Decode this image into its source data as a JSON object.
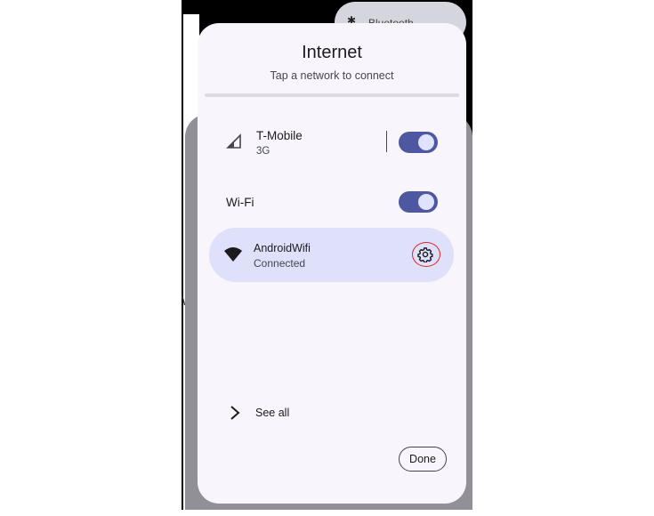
{
  "background": {
    "quick_tile_label": "Bluetooth",
    "partial_text": "W"
  },
  "dialog": {
    "title": "Internet",
    "subtitle": "Tap a network to connect"
  },
  "mobile": {
    "name": "T-Mobile",
    "type": "3G",
    "toggle_on": true,
    "icon": "cell-signal-icon"
  },
  "wifi": {
    "label": "Wi-Fi",
    "toggle_on": true
  },
  "network": {
    "name": "AndroidWifi",
    "status": "Connected",
    "icon": "wifi-icon",
    "settings_icon": "gear-icon"
  },
  "see_all": {
    "label": "See all",
    "icon": "chevron-right-icon"
  },
  "done_button": {
    "label": "Done"
  },
  "colors": {
    "dialog_bg": "#f8f6fc",
    "accent": "#4e58a0",
    "card_bg": "#dfe0fa",
    "annotation_circle": "#e32222"
  }
}
